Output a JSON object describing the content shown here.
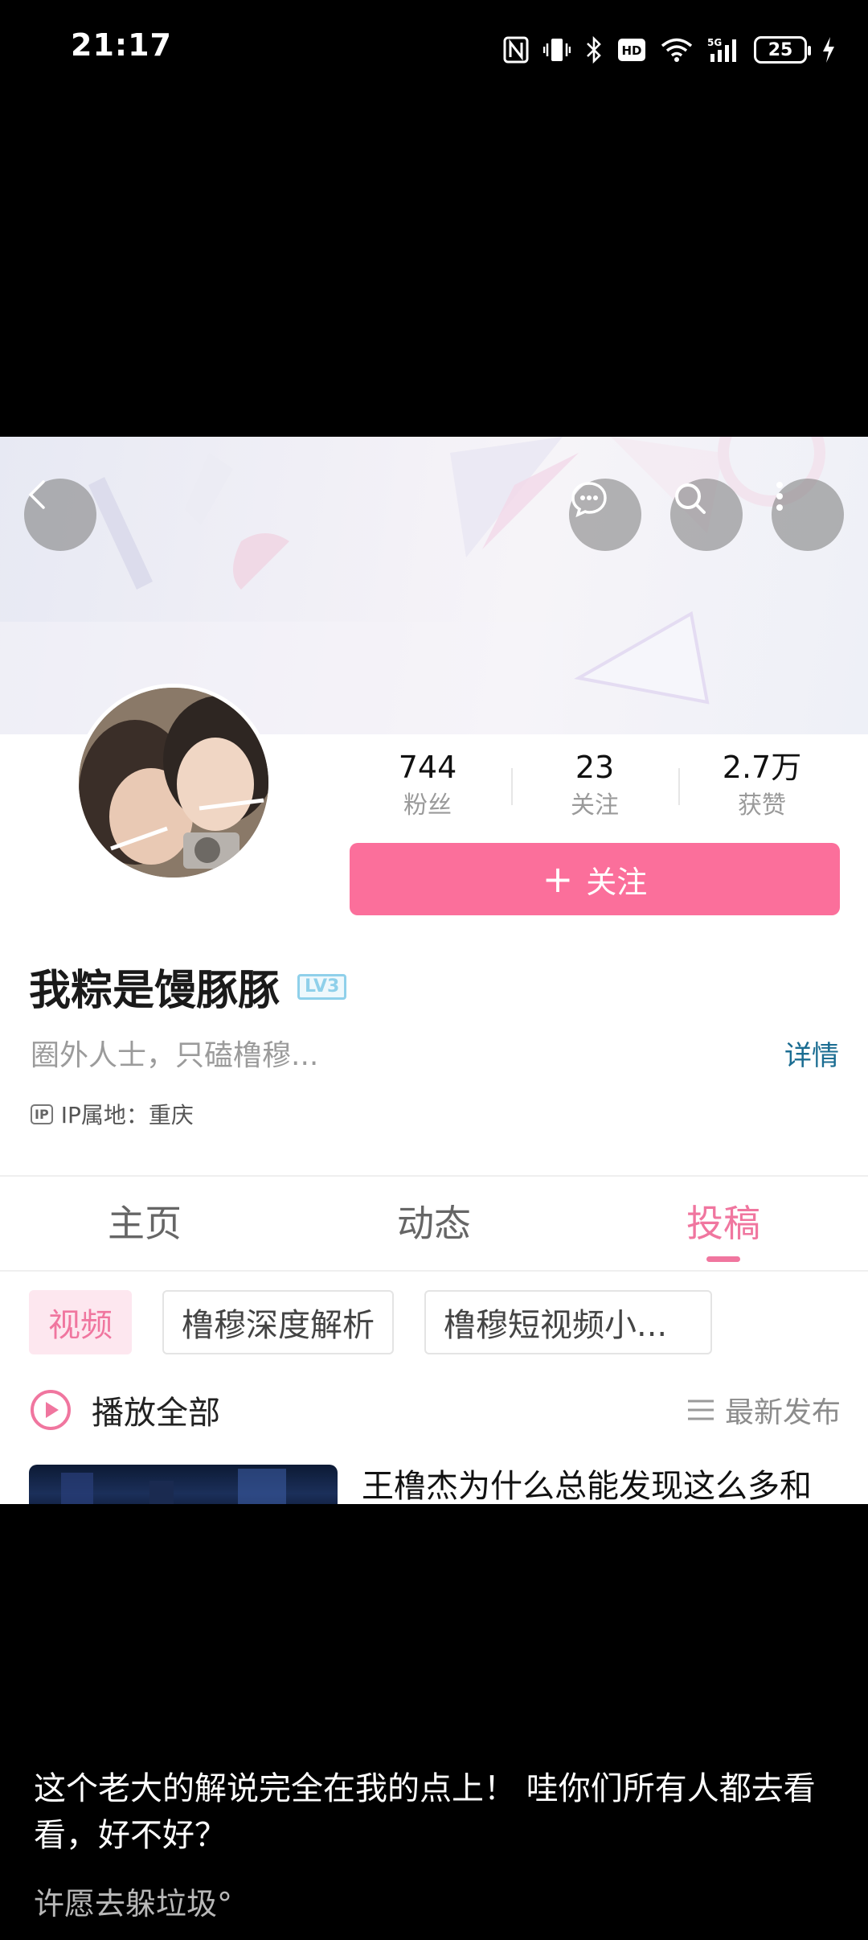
{
  "status_bar": {
    "time": "21:17",
    "battery": "25",
    "icons": [
      "nfc-icon",
      "vibrate-icon",
      "bluetooth-icon",
      "hd-icon",
      "wifi-icon",
      "signal-5g-icon",
      "battery-icon",
      "charging-icon"
    ]
  },
  "nav": {
    "icons": [
      "back-icon",
      "message-icon",
      "search-icon",
      "more-icon"
    ]
  },
  "profile": {
    "stats": [
      {
        "value": "744",
        "label": "粉丝"
      },
      {
        "value": "23",
        "label": "关注"
      },
      {
        "value": "2.7万",
        "label": "获赞"
      }
    ],
    "follow_label": "关注",
    "follow_plus": "+",
    "username": "我粽是馒豚豚",
    "level": "LV3",
    "bio": "圈外人士，只磕橹穆...",
    "detail_link": "详情",
    "ip_badge": "IP",
    "ip_location": "IP属地：重庆"
  },
  "tabs": [
    {
      "label": "主页",
      "active": false
    },
    {
      "label": "动态",
      "active": false
    },
    {
      "label": "投稿",
      "active": true
    }
  ],
  "chips": [
    {
      "label": "视频",
      "active": true
    },
    {
      "label": "橹穆深度解析",
      "active": false
    },
    {
      "label": "橹穆短视频小...",
      "active": false
    }
  ],
  "list": {
    "play_all": "播放全部",
    "sort": "最新发布",
    "first_video_title": "王橹杰为什么总能发现这么多和"
  },
  "caption": {
    "text": "这个老大的解说完全在我的点上！ 哇你们所有人都去看看，好不好？",
    "author": "许愿去躲垃圾°"
  },
  "colors": {
    "accent": "#fb6f9b",
    "tab_active": "#f0769f",
    "link": "#1b6d92"
  }
}
